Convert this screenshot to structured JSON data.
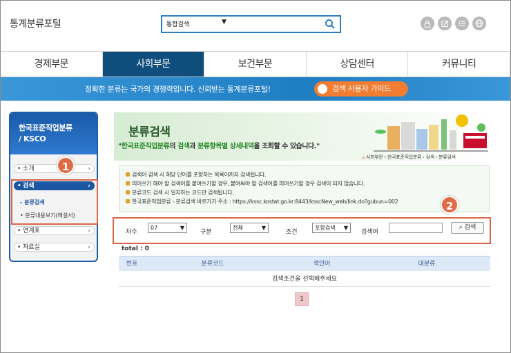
{
  "site_title": "통계분류포털",
  "search": {
    "scope": "통합검색"
  },
  "top_icons": [
    "lock-icon",
    "edit-icon",
    "list-icon",
    "globe-icon"
  ],
  "nav": [
    "경제부문",
    "사회부문",
    "보건부문",
    "상담센터",
    "커뮤니티"
  ],
  "banner": {
    "message": "정확한 분류는 국가의 경쟁력입니다. 신뢰받는 통계분류포털!",
    "guide_label": "검색 사용자 가이드"
  },
  "sidebar": {
    "title_line1": "한국표준직업분류",
    "title_line2": "/ KSCO",
    "items": [
      "소개",
      "검색",
      "연계표",
      "자료실"
    ],
    "subitems": [
      "분류검색",
      "분류내용보기(해설서)"
    ]
  },
  "hero": {
    "title": "분류검색",
    "sub_pre": "\"",
    "sub_g1": "한국표준직업분류",
    "sub_mid1": "의 ",
    "sub_g2": "검색",
    "sub_mid2": "과 ",
    "sub_g3": "분류항목별 상세내역",
    "sub_post": "을 조회할 수 있습니다.\""
  },
  "breadcrumb": "사회부문 › 한국표준직업분류 › 검색 › 분류검색",
  "info_lines": [
    "검색어 검색 시 해당 단어를 포함하는 목록어까지 검색됩니다.",
    "띄어쓰기 해야 할 검색어를 붙여쓰기할 경우, 붙여써야 할 검색어를 띄어쓰기할 경우 검색이 되지 않습니다.",
    "분류코드 검색 시 일치하는 코드만 검색됩니다.",
    "한국표준직업분류 - 분류검색 바로가기 주소 : https://kssc.kostat.go.kr:8443/ksscNew_web/link.do?gubun=002"
  ],
  "filter": {
    "label_edition": "차수",
    "edition": "07",
    "label_type": "구분",
    "type": "전체",
    "label_cond": "조건",
    "cond": "포함검색",
    "label_keyword": "검색어",
    "search_button": "검색"
  },
  "total": "total : 0",
  "table": {
    "headers": [
      "번호",
      "분류코드",
      "색인어",
      "대분류"
    ],
    "empty_message": "검색조건을 선택해주세요"
  },
  "pager": {
    "current": "1"
  },
  "annotations": [
    "1",
    "2"
  ]
}
